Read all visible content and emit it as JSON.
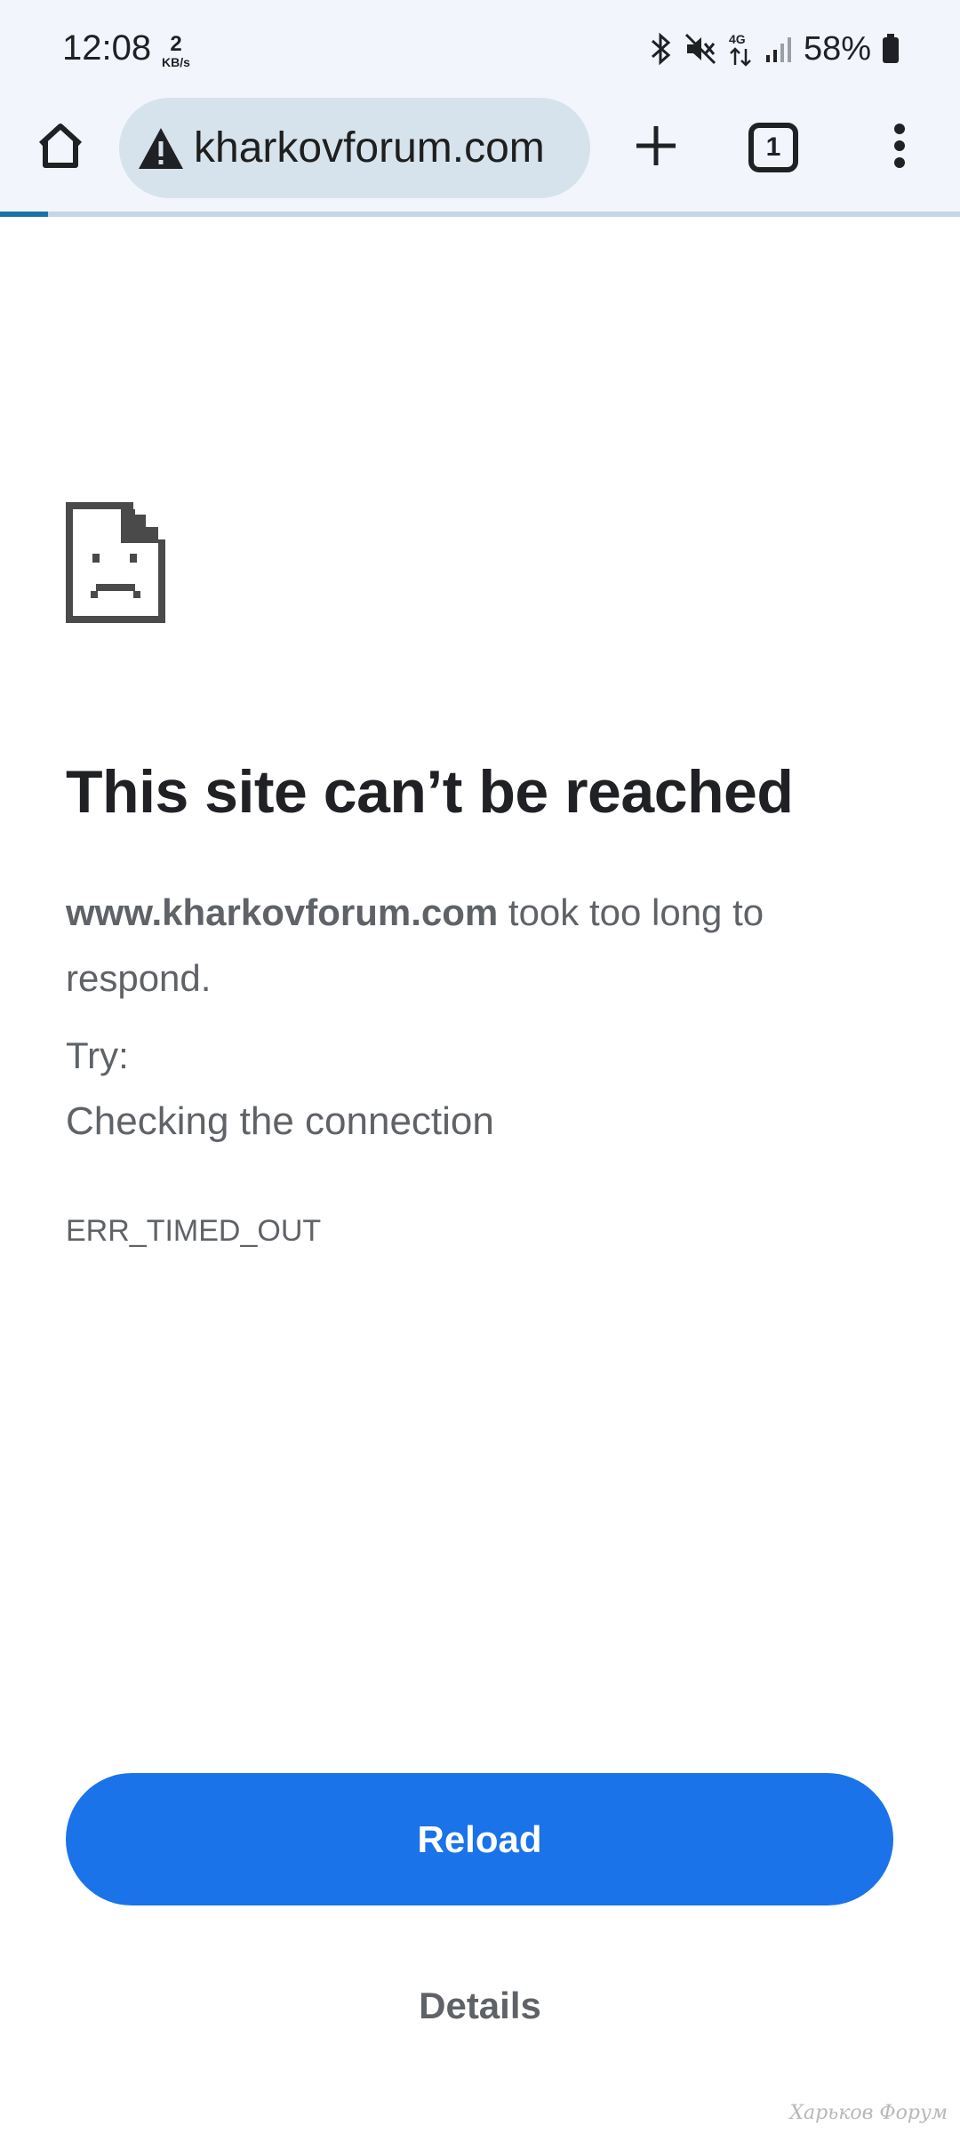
{
  "status_bar": {
    "time": "12:08",
    "net_speed_value": "2",
    "net_speed_unit": "KB/s",
    "network_type": "4G",
    "battery": "58%"
  },
  "toolbar": {
    "url": "kharkovforum.com",
    "tab_count": "1"
  },
  "page_load_progress": 0.05,
  "error": {
    "title": "This site can’t be reached",
    "host": "www.kharkovforum.com",
    "message": " took too long to respond.",
    "try_label": "Try:",
    "suggestion": "Checking the connection",
    "code": "ERR_TIMED_OUT"
  },
  "actions": {
    "reload_label": "Reload",
    "details_label": "Details"
  },
  "watermark": "Харьков Форум",
  "colors": {
    "accent_blue": "#1a73e8",
    "omnibox_bg": "#d6e3ec",
    "toolbar_bg": "#f2f6fc"
  }
}
